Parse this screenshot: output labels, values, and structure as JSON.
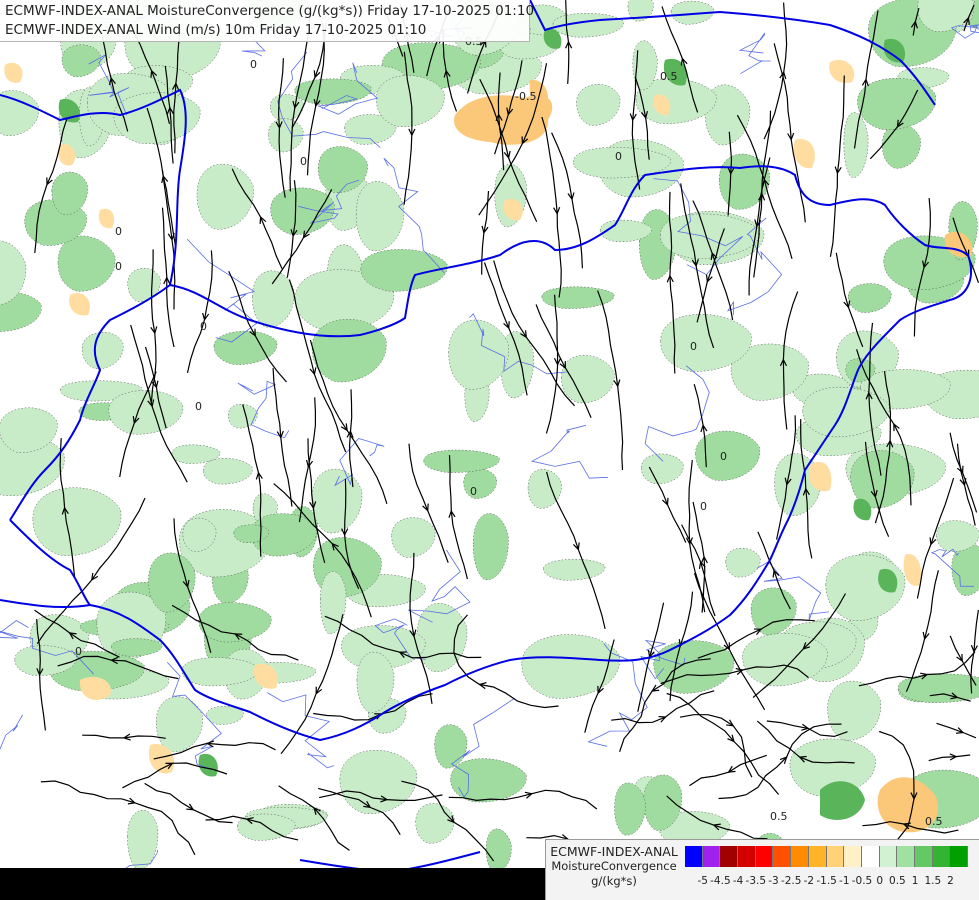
{
  "title": {
    "line1": "ECMWF-INDEX-ANAL MoistureConvergence (g/(kg*s)) Friday 17-10-2025 01:10",
    "line2": "ECMWF-INDEX-ANAL Wind (m/s) 10m Friday 17-10-2025 01:10"
  },
  "legend": {
    "model": "ECMWF-INDEX-ANAL",
    "variable": "MoistureConvergence",
    "unit": "g/(kg*s)",
    "colors": [
      "#0000ff",
      "#a020f0",
      "#a00000",
      "#d40000",
      "#ff0000",
      "#ff5000",
      "#ff8c00",
      "#ffb428",
      "#ffd278",
      "#fff0c8",
      "#ffffff",
      "#d2f0d2",
      "#a0e0a0",
      "#64c864",
      "#32b432",
      "#00a000"
    ],
    "tick_labels": [
      "-5",
      "-4.5",
      "-4",
      "-3.5",
      "-3",
      "-2.5",
      "-2",
      "-1.5",
      "-1",
      "-0.5",
      "0",
      "0.5",
      "1",
      "1.5",
      "2"
    ]
  },
  "map_labels": {
    "contour_zero": "0",
    "contour_half": "0.5",
    "contour_neg_half": "-0.5"
  },
  "colors": {
    "green_light": "#c8ebc8",
    "green_mid": "#a0dca0",
    "green_dark": "#5ab45a",
    "orange_light": "#ffdca0",
    "orange_mid": "#fac878",
    "border": "#0000e6",
    "river": "#5a6ee6",
    "streamline": "#000000"
  }
}
